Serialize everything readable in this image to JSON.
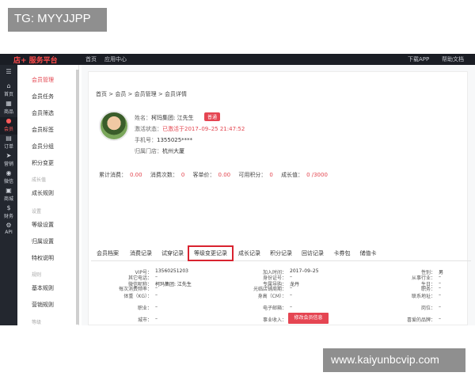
{
  "watermarks": {
    "top_left": "TG: MYYJJPP",
    "bottom_right": "www.kaiyunbcvip.com"
  },
  "topbar": {
    "brand": "店+ 服务平台",
    "nav": [
      "首页",
      "应用中心"
    ],
    "right": [
      "下载APP",
      "帮助文档"
    ]
  },
  "rail": [
    {
      "icon": "menu-icon",
      "glyph": "☰",
      "label": ""
    },
    {
      "icon": "home-icon",
      "glyph": "⌂",
      "label": "首页"
    },
    {
      "icon": "grid-icon",
      "glyph": "▦",
      "label": "商品"
    },
    {
      "icon": "member-icon",
      "glyph": "●",
      "label": "会员"
    },
    {
      "icon": "order-icon",
      "glyph": "▤",
      "label": "订单"
    },
    {
      "icon": "marketing-icon",
      "glyph": "➤",
      "label": "营销"
    },
    {
      "icon": "wechat-icon",
      "glyph": "◉",
      "label": "微信"
    },
    {
      "icon": "store-icon",
      "glyph": "▣",
      "label": "商城"
    },
    {
      "icon": "finance-icon",
      "glyph": "$",
      "label": "财务"
    },
    {
      "icon": "api-icon",
      "glyph": "⚙",
      "label": "API"
    }
  ],
  "subnav": {
    "items": [
      {
        "label": "会员管理",
        "active": true
      },
      {
        "label": "会员任务",
        "active": false
      },
      {
        "label": "会员筛选",
        "active": false
      },
      {
        "label": "会员标签",
        "active": false
      },
      {
        "label": "会员分组",
        "active": false
      },
      {
        "label": "积分变更",
        "active": false
      }
    ],
    "group1": "成长值",
    "items2": [
      {
        "label": "成长规则",
        "active": false
      }
    ],
    "group2": "设置",
    "items3": [
      {
        "label": "等级设置",
        "active": false
      },
      {
        "label": "归属设置",
        "active": false
      },
      {
        "label": "特权说明",
        "active": false
      }
    ],
    "group3": "规则",
    "items4": [
      {
        "label": "基本规则",
        "active": false
      },
      {
        "label": "营销规则",
        "active": false
      }
    ],
    "group4": "等级"
  },
  "breadcrumb": "首页 > 会员 > 会员管理 > 会员详情",
  "profile": {
    "name_label": "姓名：",
    "name": "柯玛集团: 江先生",
    "badge": "普通",
    "status_label": "激活状态：",
    "status": "已激活于2017–09–25 21:47:52",
    "phone_label": "手机号：",
    "phone": "1355025****",
    "store_label": "归属门店：",
    "store": "杭州大厦"
  },
  "stats": [
    {
      "label": "累计消费：",
      "value": "0.00"
    },
    {
      "label": "消费次数：",
      "value": "0"
    },
    {
      "label": "客单价：",
      "value": "0.00"
    },
    {
      "label": "可用积分：",
      "value": "0"
    },
    {
      "label": "成长值：",
      "value": "0 /3000"
    }
  ],
  "tabs": [
    "会员档案",
    "消费记录",
    "试穿记录",
    "等级变更记录",
    "成长记录",
    "积分记录",
    "回访记录",
    "卡券包",
    "储值卡"
  ],
  "active_tab": 3,
  "fields_left": [
    {
      "label": "VIP号：",
      "value": "13560251203"
    },
    {
      "label": "微信昵称：",
      "value": "柯玛集团: 江先生"
    },
    {
      "label": "体重（KG）：",
      "value": "–"
    },
    {
      "label": "职业：",
      "value": "–"
    },
    {
      "label": "城市：",
      "value": "–"
    },
    {
      "label": "其它电话：",
      "value": "–"
    },
    {
      "label": "每次消费频率：",
      "value": "–"
    }
  ],
  "fields_mid": [
    {
      "label": "加入时间：",
      "value": "2017–09–25"
    },
    {
      "label": "专属导购：",
      "value": "龙丹"
    },
    {
      "label": "身高（CM）：",
      "value": "–"
    },
    {
      "label": "电子邮箱：",
      "value": "–"
    },
    {
      "label": "事业收入：",
      "value": "–"
    },
    {
      "label": "身份证号：",
      "value": "–"
    },
    {
      "label": "光临店铺周期：",
      "value": "–"
    }
  ],
  "fields_right": [
    {
      "label": "性别：",
      "value": "男"
    },
    {
      "label": "生日：",
      "value": "–"
    },
    {
      "label": "联系地址：",
      "value": "–"
    },
    {
      "label": "岗位：",
      "value": "–"
    },
    {
      "label": "喜爱的品牌：",
      "value": "–"
    },
    {
      "label": "从事行业：",
      "value": "–"
    },
    {
      "label": "职务：",
      "value": "–"
    }
  ],
  "modify_button": "修改会员信息"
}
